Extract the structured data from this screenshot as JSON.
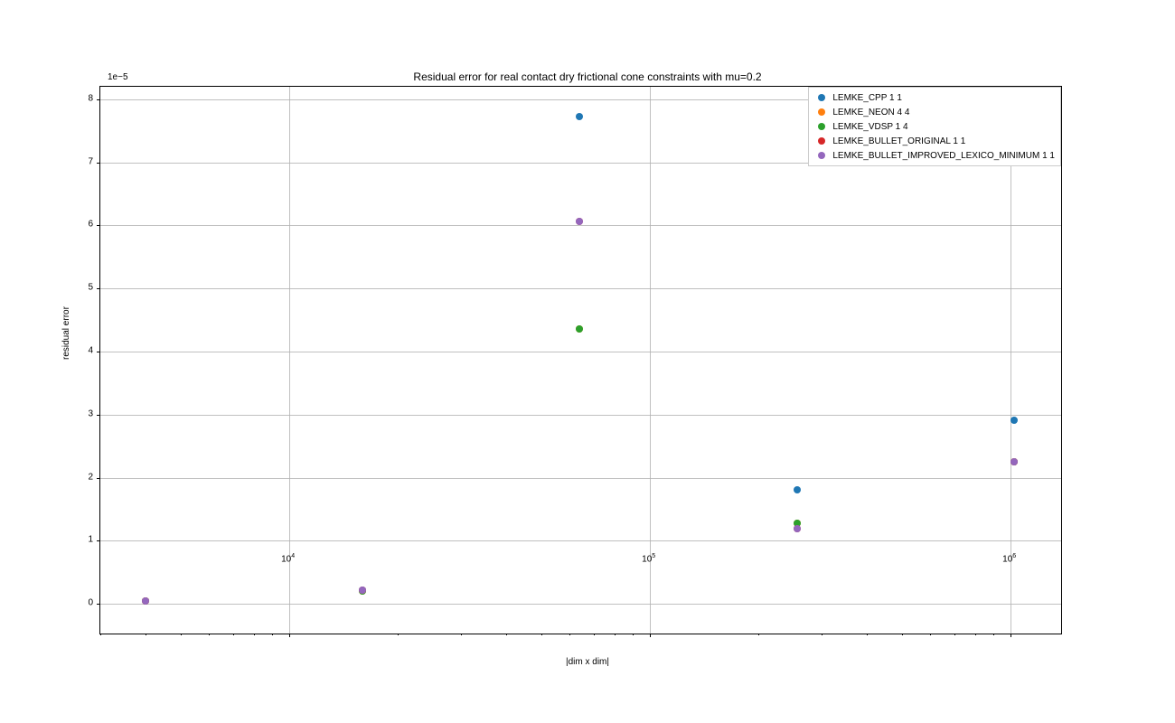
{
  "chart_data": {
    "type": "scatter",
    "title": "Residual error for real contact dry frictional cone constraints with mu=0.2",
    "xlabel": "|dim x dim|",
    "ylabel": "residual error",
    "y_exponent_label": "1e−5",
    "xscale": "log",
    "xlim": [
      3000,
      1400000
    ],
    "ylim": [
      -5e-06,
      8.2e-05
    ],
    "y_ticks": [
      0,
      1,
      2,
      3,
      4,
      5,
      6,
      7,
      8
    ],
    "y_tick_scale": 1e-05,
    "x_ticks": [
      {
        "value": 10000,
        "label_html": "10<sup>4</sup>"
      },
      {
        "value": 100000,
        "label_html": "10<sup>5</sup>"
      },
      {
        "value": 1000000,
        "label_html": "10<sup>6</sup>"
      }
    ],
    "series": [
      {
        "name": "LEMKE_CPP 1 1",
        "color": "#1f77b4",
        "points": [
          {
            "x": 4000,
            "y": 5e-07
          },
          {
            "x": 16000,
            "y": 2.2e-06
          },
          {
            "x": 64000,
            "y": 7.73e-05
          },
          {
            "x": 256000,
            "y": 1.81e-05
          },
          {
            "x": 1024000,
            "y": 2.91e-05
          }
        ]
      },
      {
        "name": "LEMKE_NEON 4 4",
        "color": "#ff7f0e",
        "points": [
          {
            "x": 4000,
            "y": 5e-07
          },
          {
            "x": 16000,
            "y": 2e-06
          },
          {
            "x": 64000,
            "y": 4.36e-05
          },
          {
            "x": 256000,
            "y": 1.28e-05
          },
          {
            "x": 1024000,
            "y": 2.25e-05
          }
        ]
      },
      {
        "name": "LEMKE_VDSP 1 4",
        "color": "#2ca02c",
        "points": [
          {
            "x": 4000,
            "y": 5e-07
          },
          {
            "x": 16000,
            "y": 2e-06
          },
          {
            "x": 64000,
            "y": 4.36e-05
          },
          {
            "x": 256000,
            "y": 1.28e-05
          },
          {
            "x": 1024000,
            "y": 2.25e-05
          }
        ]
      },
      {
        "name": "LEMKE_BULLET_ORIGINAL 1 1",
        "color": "#d62728",
        "points": [
          {
            "x": 4000,
            "y": 5e-07
          },
          {
            "x": 16000,
            "y": 2.2e-06
          },
          {
            "x": 64000,
            "y": 6.06e-05
          },
          {
            "x": 256000,
            "y": 1.19e-05
          },
          {
            "x": 1024000,
            "y": 2.25e-05
          }
        ]
      },
      {
        "name": "LEMKE_BULLET_IMPROVED_LEXICO_MINIMUM 1 1",
        "color": "#9467bd",
        "points": [
          {
            "x": 4000,
            "y": 5e-07
          },
          {
            "x": 16000,
            "y": 2.2e-06
          },
          {
            "x": 64000,
            "y": 6.06e-05
          },
          {
            "x": 256000,
            "y": 1.19e-05
          },
          {
            "x": 1024000,
            "y": 2.25e-05
          }
        ]
      }
    ]
  }
}
